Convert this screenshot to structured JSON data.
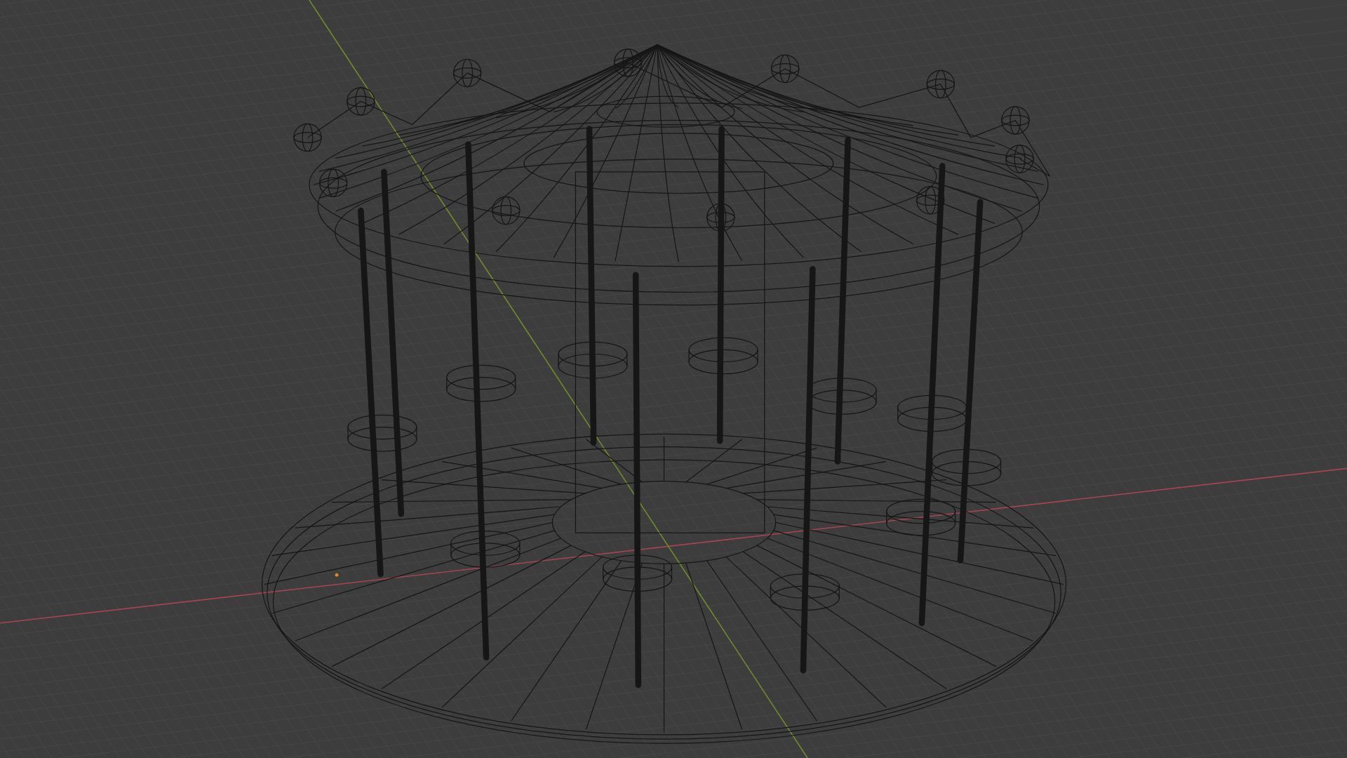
{
  "viewport": {
    "wireframe": true,
    "show_grid": true,
    "show_axes": true,
    "show_origin": true
  }
}
